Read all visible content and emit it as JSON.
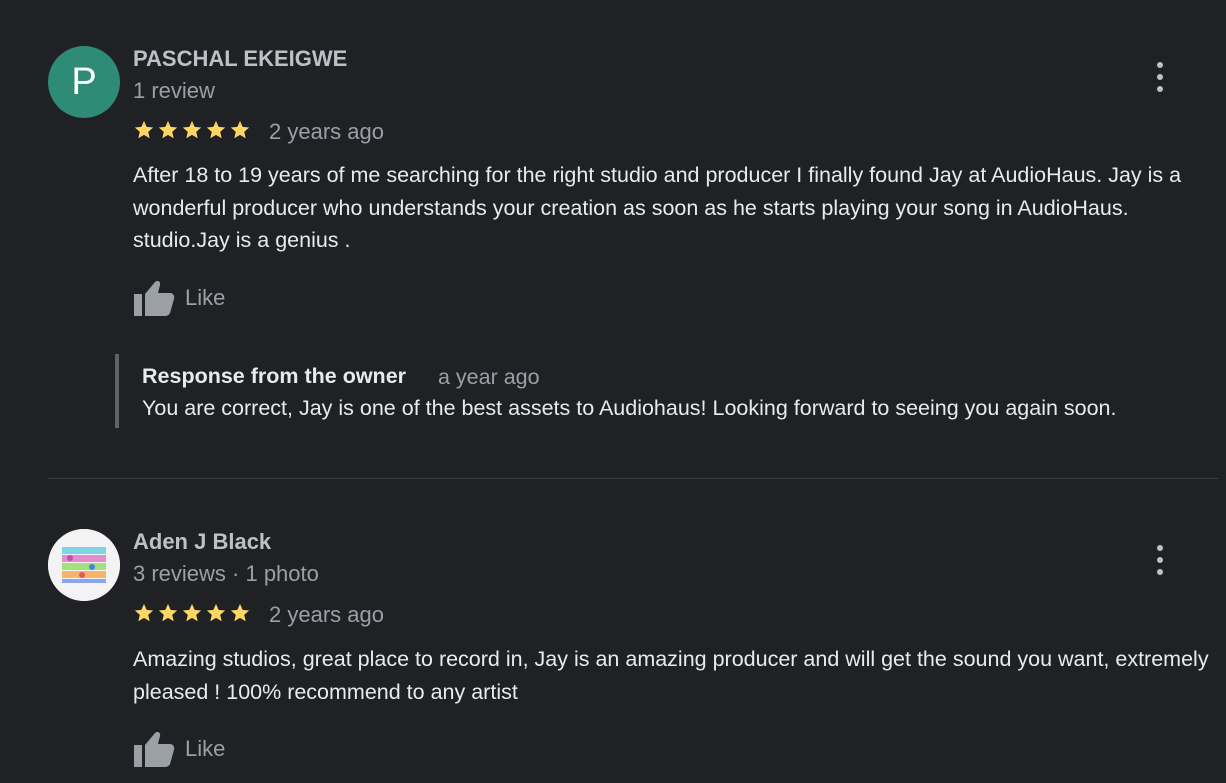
{
  "reviews": [
    {
      "author": "PASCHAL EKEIGWE",
      "avatar_letter": "P",
      "avatar_color": "#2e8b75",
      "meta": "1 review",
      "rating": 5,
      "time": "2 years ago",
      "text": "After 18 to 19 years of me searching for the right studio and producer I finally found Jay at AudioHaus. Jay is a wonderful producer who understands your creation  as soon as he starts playing your song in AudioHaus. studio.Jay is a genius .",
      "like_label": "Like",
      "owner_response": {
        "title": "Response from the owner",
        "time": "a year ago",
        "text": "You are correct, Jay is one of the best assets to Audiohaus! Looking forward to seeing you again soon."
      }
    },
    {
      "author": "Aden J Black",
      "meta": "3 reviews · 1 photo",
      "rating": 5,
      "time": "2 years ago",
      "text": "Amazing studios, great place to record in, Jay is an amazing producer and will get the sound you want, extremely pleased ! 100% recommend to any artist",
      "like_label": "Like"
    }
  ],
  "colors": {
    "background": "#202124",
    "star": "#fdd663",
    "muted_text": "#9aa0a6",
    "divider": "#3c4043"
  },
  "icons": {
    "star": "star-icon",
    "like": "thumbs-up-icon",
    "more": "more-vert-icon"
  }
}
